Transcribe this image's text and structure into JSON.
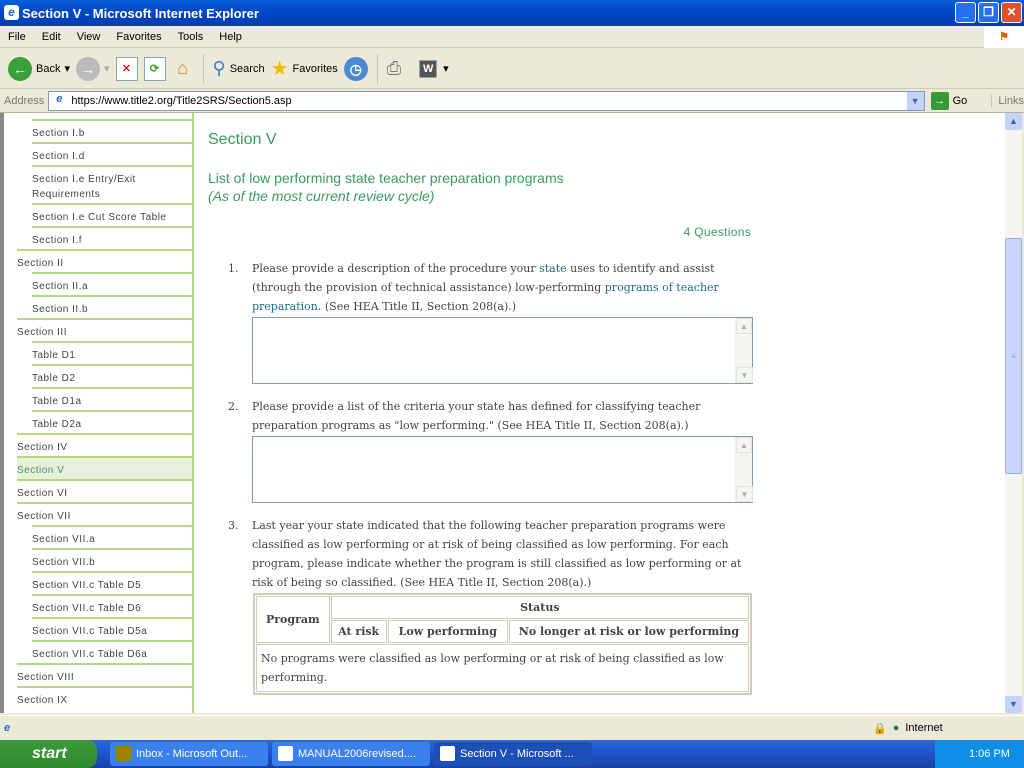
{
  "window": {
    "title": "Section V - Microsoft Internet Explorer"
  },
  "menu": [
    "File",
    "Edit",
    "View",
    "Favorites",
    "Tools",
    "Help"
  ],
  "toolbar": {
    "back": "Back",
    "search": "Search",
    "favorites": "Favorites"
  },
  "address": {
    "label": "Address",
    "url": "https://www.title2.org/Title2SRS/Section5.asp",
    "go": "Go",
    "links": "Links"
  },
  "sidebar": {
    "items": [
      {
        "label": "Section I.b",
        "level": 2
      },
      {
        "label": "Section I.d",
        "level": 2
      },
      {
        "label": "Section I.e Entry/Exit Requirements",
        "level": 2
      },
      {
        "label": "Section I.e Cut Score Table",
        "level": 2
      },
      {
        "label": "Section I.f",
        "level": 2
      },
      {
        "label": "Section II",
        "level": 1
      },
      {
        "label": "Section II.a",
        "level": 2
      },
      {
        "label": "Section II.b",
        "level": 2
      },
      {
        "label": "Section III",
        "level": 1
      },
      {
        "label": "Table D1",
        "level": 2
      },
      {
        "label": "Table D2",
        "level": 2
      },
      {
        "label": "Table D1a",
        "level": 2
      },
      {
        "label": "Table D2a",
        "level": 2
      },
      {
        "label": "Section IV",
        "level": 1
      },
      {
        "label": "Section V",
        "level": 1,
        "active": true
      },
      {
        "label": "Section VI",
        "level": 1
      },
      {
        "label": "Section VII",
        "level": 1
      },
      {
        "label": "Section VII.a",
        "level": 2
      },
      {
        "label": "Section VII.b",
        "level": 2
      },
      {
        "label": "Section VII.c Table D5",
        "level": 2
      },
      {
        "label": "Section VII.c Table D6",
        "level": 2
      },
      {
        "label": "Section VII.c Table D5a",
        "level": 2
      },
      {
        "label": "Section VII.c Table D6a",
        "level": 2
      },
      {
        "label": "Section VIII",
        "level": 1
      },
      {
        "label": "Section IX",
        "level": 1
      }
    ]
  },
  "main": {
    "heading": "Section V",
    "subtitle": "List of low performing state teacher preparation programs",
    "subtitle_note": "(As of the most current review cycle)",
    "question_count": "4 Questions",
    "q1": {
      "num": "1.",
      "t1": "Please provide a description of the procedure your ",
      "link1": "state",
      "t2": " uses to identify and assist (through the provision of technical assistance) low-performing ",
      "link2": "programs of teacher preparation",
      "t3": ". (See HEA Title II, Section 208(a).)",
      "value": ""
    },
    "q2": {
      "num": "2.",
      "text": "Please provide a list of the criteria your state has defined for classifying teacher preparation programs as \"low performing.\" (See HEA Title II, Section 208(a).)",
      "value": ""
    },
    "q3": {
      "num": "3.",
      "text": "Last year your state indicated that the following teacher preparation programs were classified as low performing or at risk of being classified as low performing. For each program, please indicate whether the program is still classified as low performing or at risk of being so classified. (See HEA Title II, Section 208(a).)"
    },
    "table": {
      "program": "Program",
      "status": "Status",
      "cols": [
        "At risk",
        "Low performing",
        "No longer at risk or low performing"
      ],
      "empty": "No programs were classified as low performing or at risk of being classified as low performing."
    }
  },
  "status": {
    "zone": "Internet"
  },
  "taskbar": {
    "start": "start",
    "tasks": [
      "Inbox - Microsoft Out...",
      "MANUAL2006revised....",
      "Section V - Microsoft ..."
    ],
    "clock": "1:06 PM"
  }
}
